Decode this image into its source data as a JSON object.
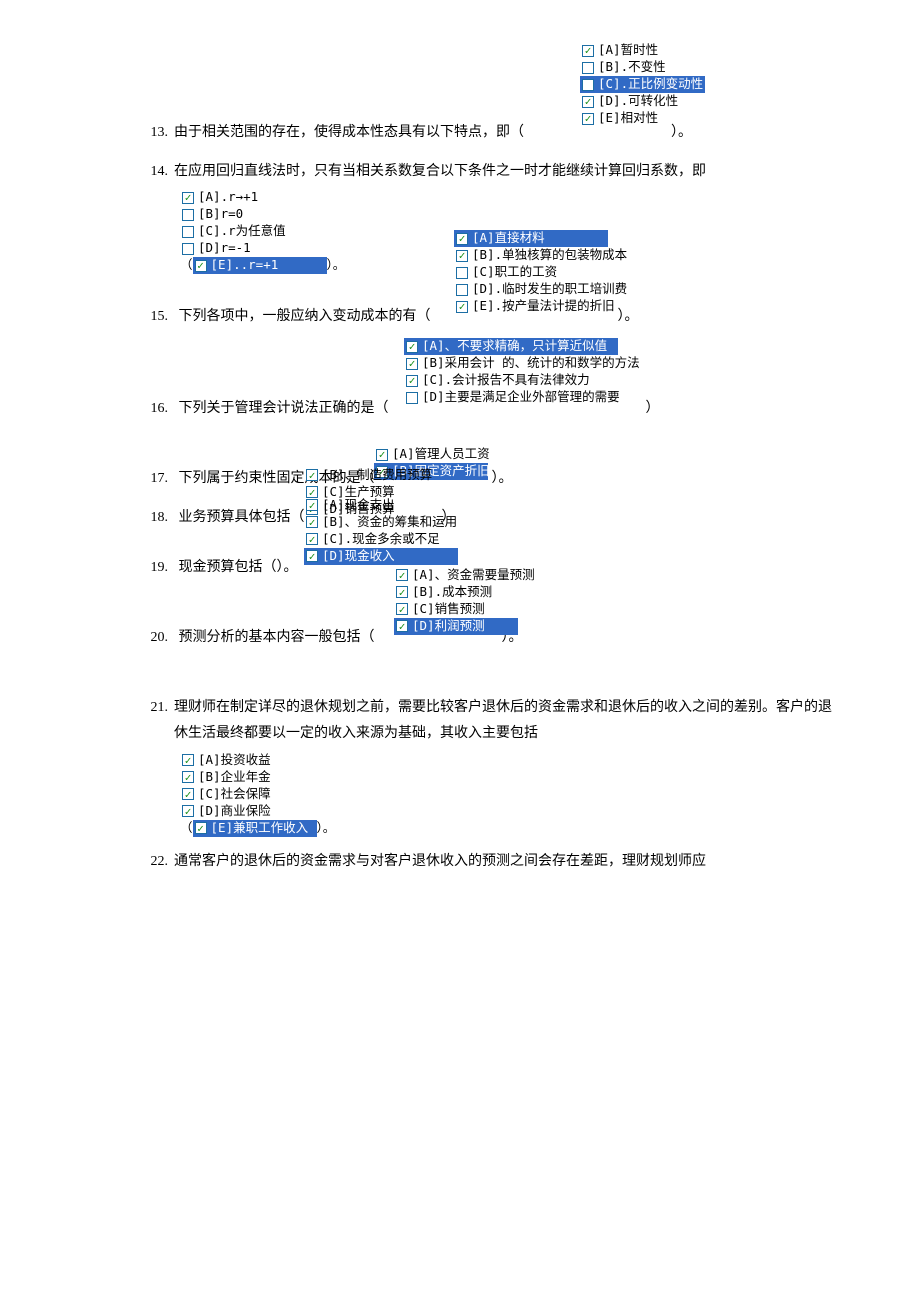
{
  "questions": [
    {
      "num": "13.",
      "pre": "由于相关范围的存在，使得成本性态具有以下特点，即（",
      "post": "）。",
      "opts_pos": "inline-top-right",
      "options": [
        {
          "label": "[A]暂时性",
          "checked": true,
          "selected": false
        },
        {
          "label": "[B].不变性",
          "checked": false,
          "selected": false
        },
        {
          "label": "[C].正比例变动性",
          "checked": false,
          "selected": true
        },
        {
          "label": "[D].可转化性",
          "checked": true,
          "selected": false
        },
        {
          "label": "[E]相对性",
          "checked": true,
          "selected": false
        }
      ]
    },
    {
      "num": "14.",
      "pre": "在应用回归直线法时，只有当相关系数复合以下条件之一时才能继续计算回归系数，即",
      "post": "）。",
      "opts_pos": "block-below-paren",
      "options": [
        {
          "label": "[A].r→+1",
          "checked": true,
          "selected": false
        },
        {
          "label": "[B]r=0",
          "checked": false,
          "selected": false
        },
        {
          "label": "[C].r为任意值",
          "checked": false,
          "selected": false
        },
        {
          "label": "[D]r=-1",
          "checked": false,
          "selected": false
        },
        {
          "label": "[E]..r=+1",
          "checked": true,
          "selected": true
        }
      ]
    },
    {
      "num": "15.",
      "pre": "下列各项中，一般应纳入变动成本的有（",
      "post": "）。",
      "opts_pos": "inline-right",
      "options": [
        {
          "label": "[A]直接材料",
          "checked": true,
          "selected": true
        },
        {
          "label": "[B].单独核算的包装物成本",
          "checked": true,
          "selected": false
        },
        {
          "label": "[C]职工的工资",
          "checked": false,
          "selected": false
        },
        {
          "label": "[D].临时发生的职工培训费",
          "checked": false,
          "selected": false
        },
        {
          "label": "[E].按产量法计提的折旧",
          "checked": true,
          "selected": false
        }
      ]
    },
    {
      "num": "16.",
      "pre": "下列关于管理会计说法正确的是（",
      "post": "）",
      "opts_pos": "inline-right",
      "options": [
        {
          "label": "[A]、不要求精确，只计算近似值",
          "checked": true,
          "selected": true
        },
        {
          "label": "[B]采用会计 的、统计的和数学的方法",
          "checked": true,
          "selected": false
        },
        {
          "label": "[C].会计报告不具有法律效力",
          "checked": true,
          "selected": false
        },
        {
          "label": "[D]主要是满足企业外部管理的需要",
          "checked": false,
          "selected": false
        }
      ]
    },
    {
      "num": "17.",
      "pre": "下列属于约束性固定成本的是（",
      "post": "）。",
      "opts_pos": "inline-right",
      "options": [
        {
          "label": "[A]管理人员工资",
          "checked": true,
          "selected": false
        },
        {
          "label": "[B]固定资产折旧",
          "checked": true,
          "selected": true
        }
      ]
    },
    {
      "num": "18.",
      "pre": "业务预算具体包括（",
      "post": "）",
      "opts_pos": "inline-right",
      "options": [
        {
          "label": "[B]、制造费用预算",
          "checked": true,
          "selected": false
        },
        {
          "label": "[C]生产预算",
          "checked": true,
          "selected": false
        },
        {
          "label": "[D]销售预算",
          "checked": true,
          "selected": false
        }
      ]
    },
    {
      "num": "19.",
      "pre": "现金预算包括（）。",
      "post": "",
      "opts_pos": "above-right",
      "options": [
        {
          "label": "[A]现金支出",
          "checked": true,
          "selected": false
        },
        {
          "label": "[B]、资金的筹集和运用",
          "checked": true,
          "selected": false
        },
        {
          "label": "[C].现金多余或不足",
          "checked": true,
          "selected": false
        },
        {
          "label": "[D]现金收入",
          "checked": true,
          "selected": true
        }
      ]
    },
    {
      "num": "20.",
      "pre": "预测分析的基本内容一般包括（",
      "post": "）。",
      "opts_pos": "inline-right",
      "options": [
        {
          "label": "[A]、资金需要量预测",
          "checked": true,
          "selected": false
        },
        {
          "label": "[B].成本预测",
          "checked": true,
          "selected": false
        },
        {
          "label": "[C]销售预测",
          "checked": true,
          "selected": false
        },
        {
          "label": "[D]利润预测",
          "checked": true,
          "selected": true
        }
      ]
    },
    {
      "num": "21.",
      "pre": "理财师在制定详尽的退休规划之前，需要比较客户退休后的资金需求和退休后的收入之间的差别。客户的退休生活最终都要以一定的收入来源为基础，其收入主要包括",
      "post": "）。",
      "opts_pos": "block-below-paren",
      "options": [
        {
          "label": "[A]投资收益",
          "checked": true,
          "selected": false
        },
        {
          "label": "[B]企业年金",
          "checked": true,
          "selected": false
        },
        {
          "label": "[C]社会保障",
          "checked": true,
          "selected": false
        },
        {
          "label": "[D]商业保险",
          "checked": true,
          "selected": false
        },
        {
          "label": "[E]兼职工作收入",
          "checked": true,
          "selected": true
        }
      ]
    },
    {
      "num": "22.",
      "pre": "通常客户的退休后的资金需求与对客户退休收入的预测之间会存在差距，理财规划师应",
      "post": "",
      "opts_pos": "none",
      "options": []
    }
  ]
}
